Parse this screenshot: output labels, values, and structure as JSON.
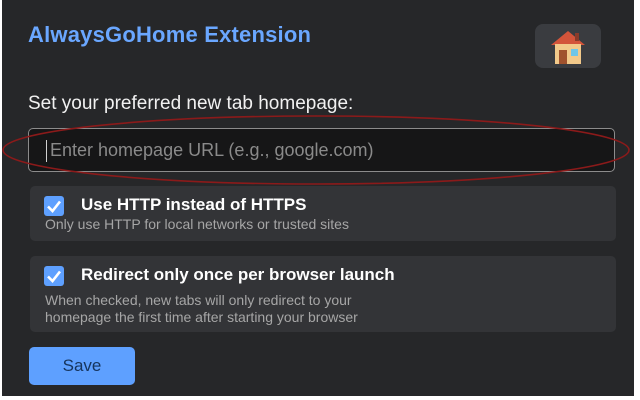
{
  "header": {
    "title": "AlwaysGoHome Extension",
    "logo_icon": "house-icon"
  },
  "homepage": {
    "prompt": "Set your preferred new tab homepage:",
    "url_value": "",
    "url_placeholder": "Enter homepage URL (e.g., google.com)"
  },
  "options": [
    {
      "label": "Use HTTP instead of HTTPS",
      "description": "Only use HTTP for local networks or trusted sites",
      "checked": true
    },
    {
      "label": "Redirect only once per browser launch",
      "description_line1": "When checked, new tabs will only redirect to your",
      "description_line2": "homepage the first time after starting your browser",
      "checked": true
    }
  ],
  "actions": {
    "save_label": "Save"
  },
  "colors": {
    "background": "#262729",
    "accent": "#5ea0ff",
    "title": "#6aa7ff",
    "highlight": "#8b1a1a"
  }
}
